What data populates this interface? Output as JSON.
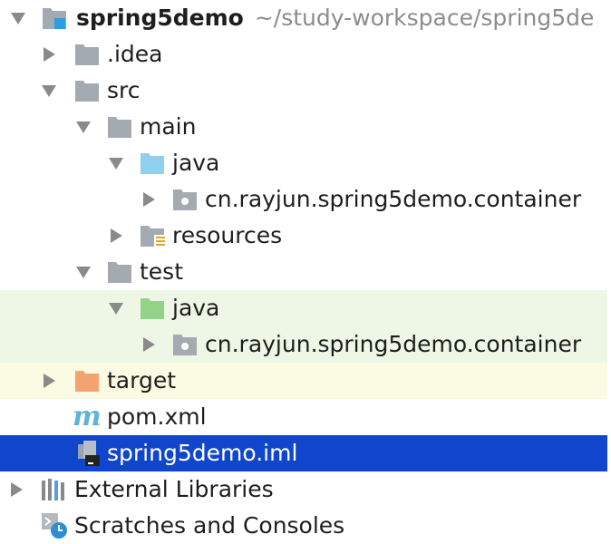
{
  "project": {
    "name": "spring5demo",
    "path": "~/study-workspace/spring5de"
  },
  "tree": {
    "idea": ".idea",
    "src": "src",
    "main": "main",
    "main_java": "java",
    "main_package": "cn.rayjun.spring5demo.container",
    "resources": "resources",
    "test": "test",
    "test_java": "java",
    "test_package": "cn.rayjun.spring5demo.container",
    "target": "target",
    "pom": "pom.xml",
    "iml": "spring5demo.iml",
    "external_libraries": "External Libraries",
    "scratches": "Scratches and Consoles"
  },
  "colors": {
    "folder_gray": "#a3aab2",
    "source_folder_blue": "#8fd0ee",
    "test_folder_green": "#93d388",
    "excluded_folder_orange": "#f5a271",
    "selection": "#0f46cc"
  }
}
